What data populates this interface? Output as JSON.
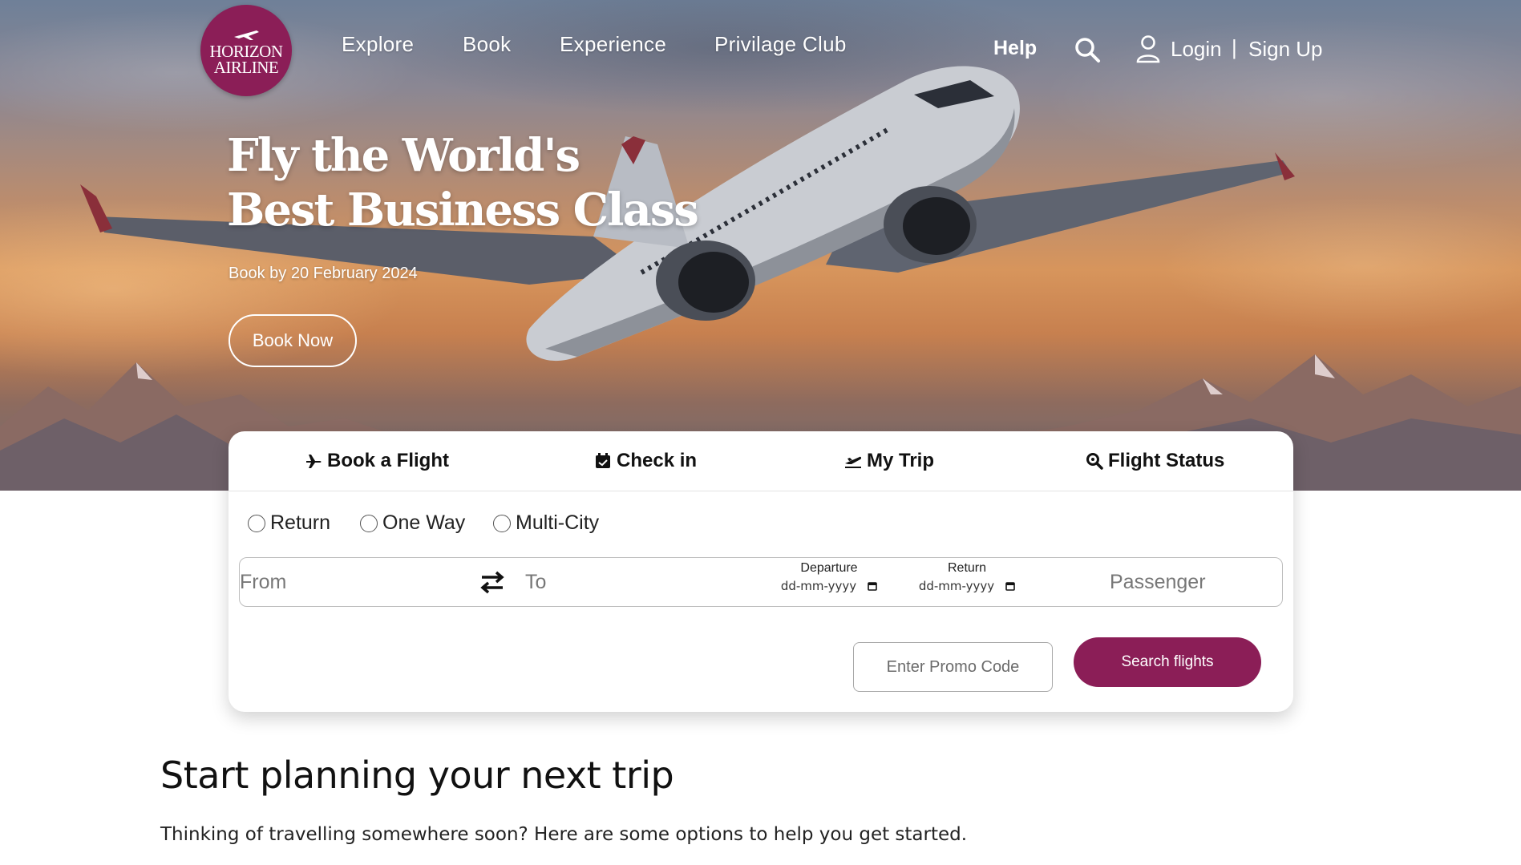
{
  "brand": {
    "logo_line1": "HORIZON",
    "logo_line2": "AIRLINE",
    "color_primary": "#8b1e57"
  },
  "nav": {
    "links": [
      "Explore",
      "Book",
      "Experience",
      "Privilage Club"
    ],
    "help": "Help",
    "search_icon": "search-icon",
    "user_icon": "user-icon",
    "login": "Login",
    "separator": "|",
    "signup": "Sign Up"
  },
  "hero": {
    "title_line1": "Fly the World's",
    "title_line2": "Best Business Class",
    "subtitle": "Book by 20 February 2024",
    "cta": "Book Now"
  },
  "booking": {
    "tabs": [
      {
        "label": "Book a Flight",
        "icon": "airplane-icon"
      },
      {
        "label": "Check in",
        "icon": "calendar-check-icon"
      },
      {
        "label": "My Trip",
        "icon": "plane-departure-icon"
      },
      {
        "label": "Flight Status",
        "icon": "magnifier-icon"
      }
    ],
    "trip_types": [
      "Return",
      "One Way",
      "Multi-City"
    ],
    "from_placeholder": "From",
    "to_placeholder": "To",
    "swap_icon": "swap-arrows-icon",
    "departure_label": "Departure",
    "departure_value": "dd-mm-yyyy",
    "return_label": "Return",
    "return_value": "dd-mm-yyyy",
    "passenger_placeholder": "Passenger",
    "promo_placeholder": "Enter Promo Code",
    "search_button": "Search flights"
  },
  "section": {
    "title": "Start planning your next trip",
    "subtitle": "Thinking of travelling somewhere soon? Here are some options to help you get started."
  }
}
